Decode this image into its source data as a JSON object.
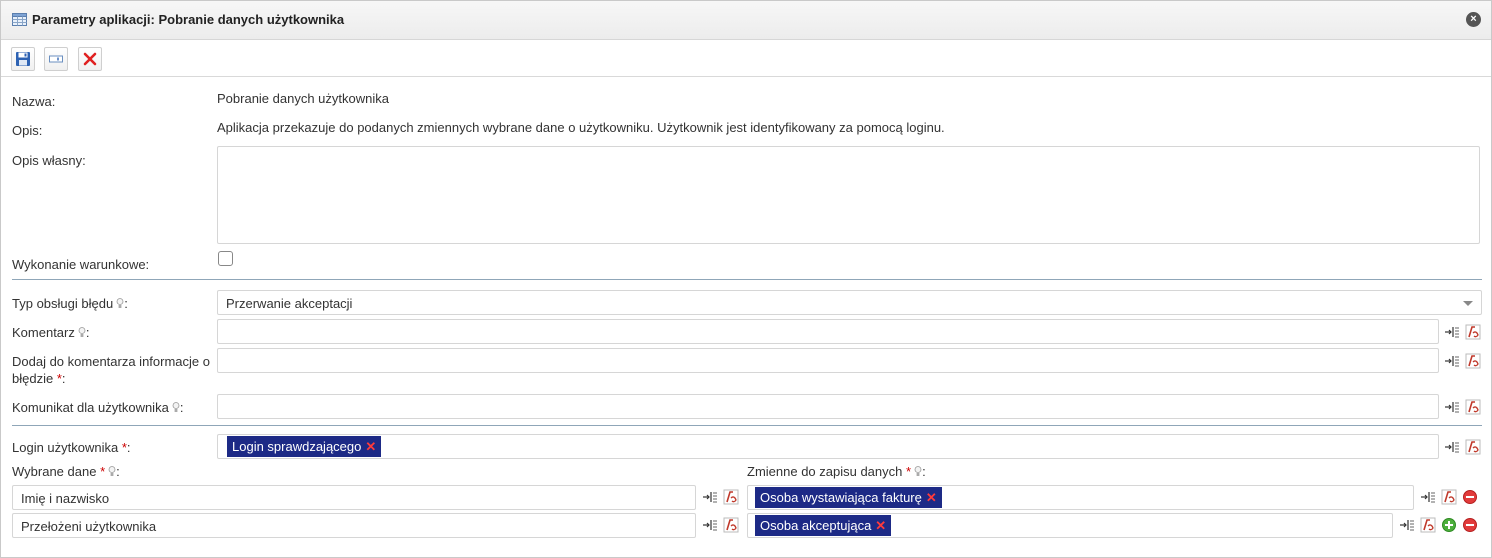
{
  "window": {
    "title": "Parametry aplikacji: Pobranie danych użytkownika",
    "close_icon": "×"
  },
  "colors": {
    "tag_bg": "#1d2a86",
    "required": "#cc0000",
    "separator": "#8fa6b8"
  },
  "toolbar": {
    "icons": [
      "save-icon",
      "field-icon",
      "delete-icon"
    ]
  },
  "form": {
    "name_label": "Nazwa:",
    "name_value": "Pobranie danych użytkownika",
    "desc_label": "Opis:",
    "desc_value": "Aplikacja przekazuje do podanych zmiennych wybrane dane o użytkowniku. Użytkownik jest identyfikowany za pomocą loginu.",
    "own_desc_label": "Opis własny:",
    "conditional_label": "Wykonanie warunkowe:",
    "error_type_label": "Typ obsługi błędu",
    "error_type_value": "Przerwanie akceptacji",
    "comment_label": "Komentarz",
    "add_to_comment_label": "Dodaj do komentarza informacje o błędzie",
    "user_message_label": "Komunikat dla użytkownika",
    "login_label": "Login użytkownika",
    "login_tag": "Login sprawdzającego",
    "selected_data_label": "Wybrane dane",
    "variables_label": "Zmienne do zapisu danych",
    "rows": [
      {
        "data": "Imię i nazwisko",
        "variable": "Osoba wystawiająca fakturę"
      },
      {
        "data": "Przełożeni użytkownika",
        "variable": "Osoba akceptująca"
      }
    ]
  }
}
